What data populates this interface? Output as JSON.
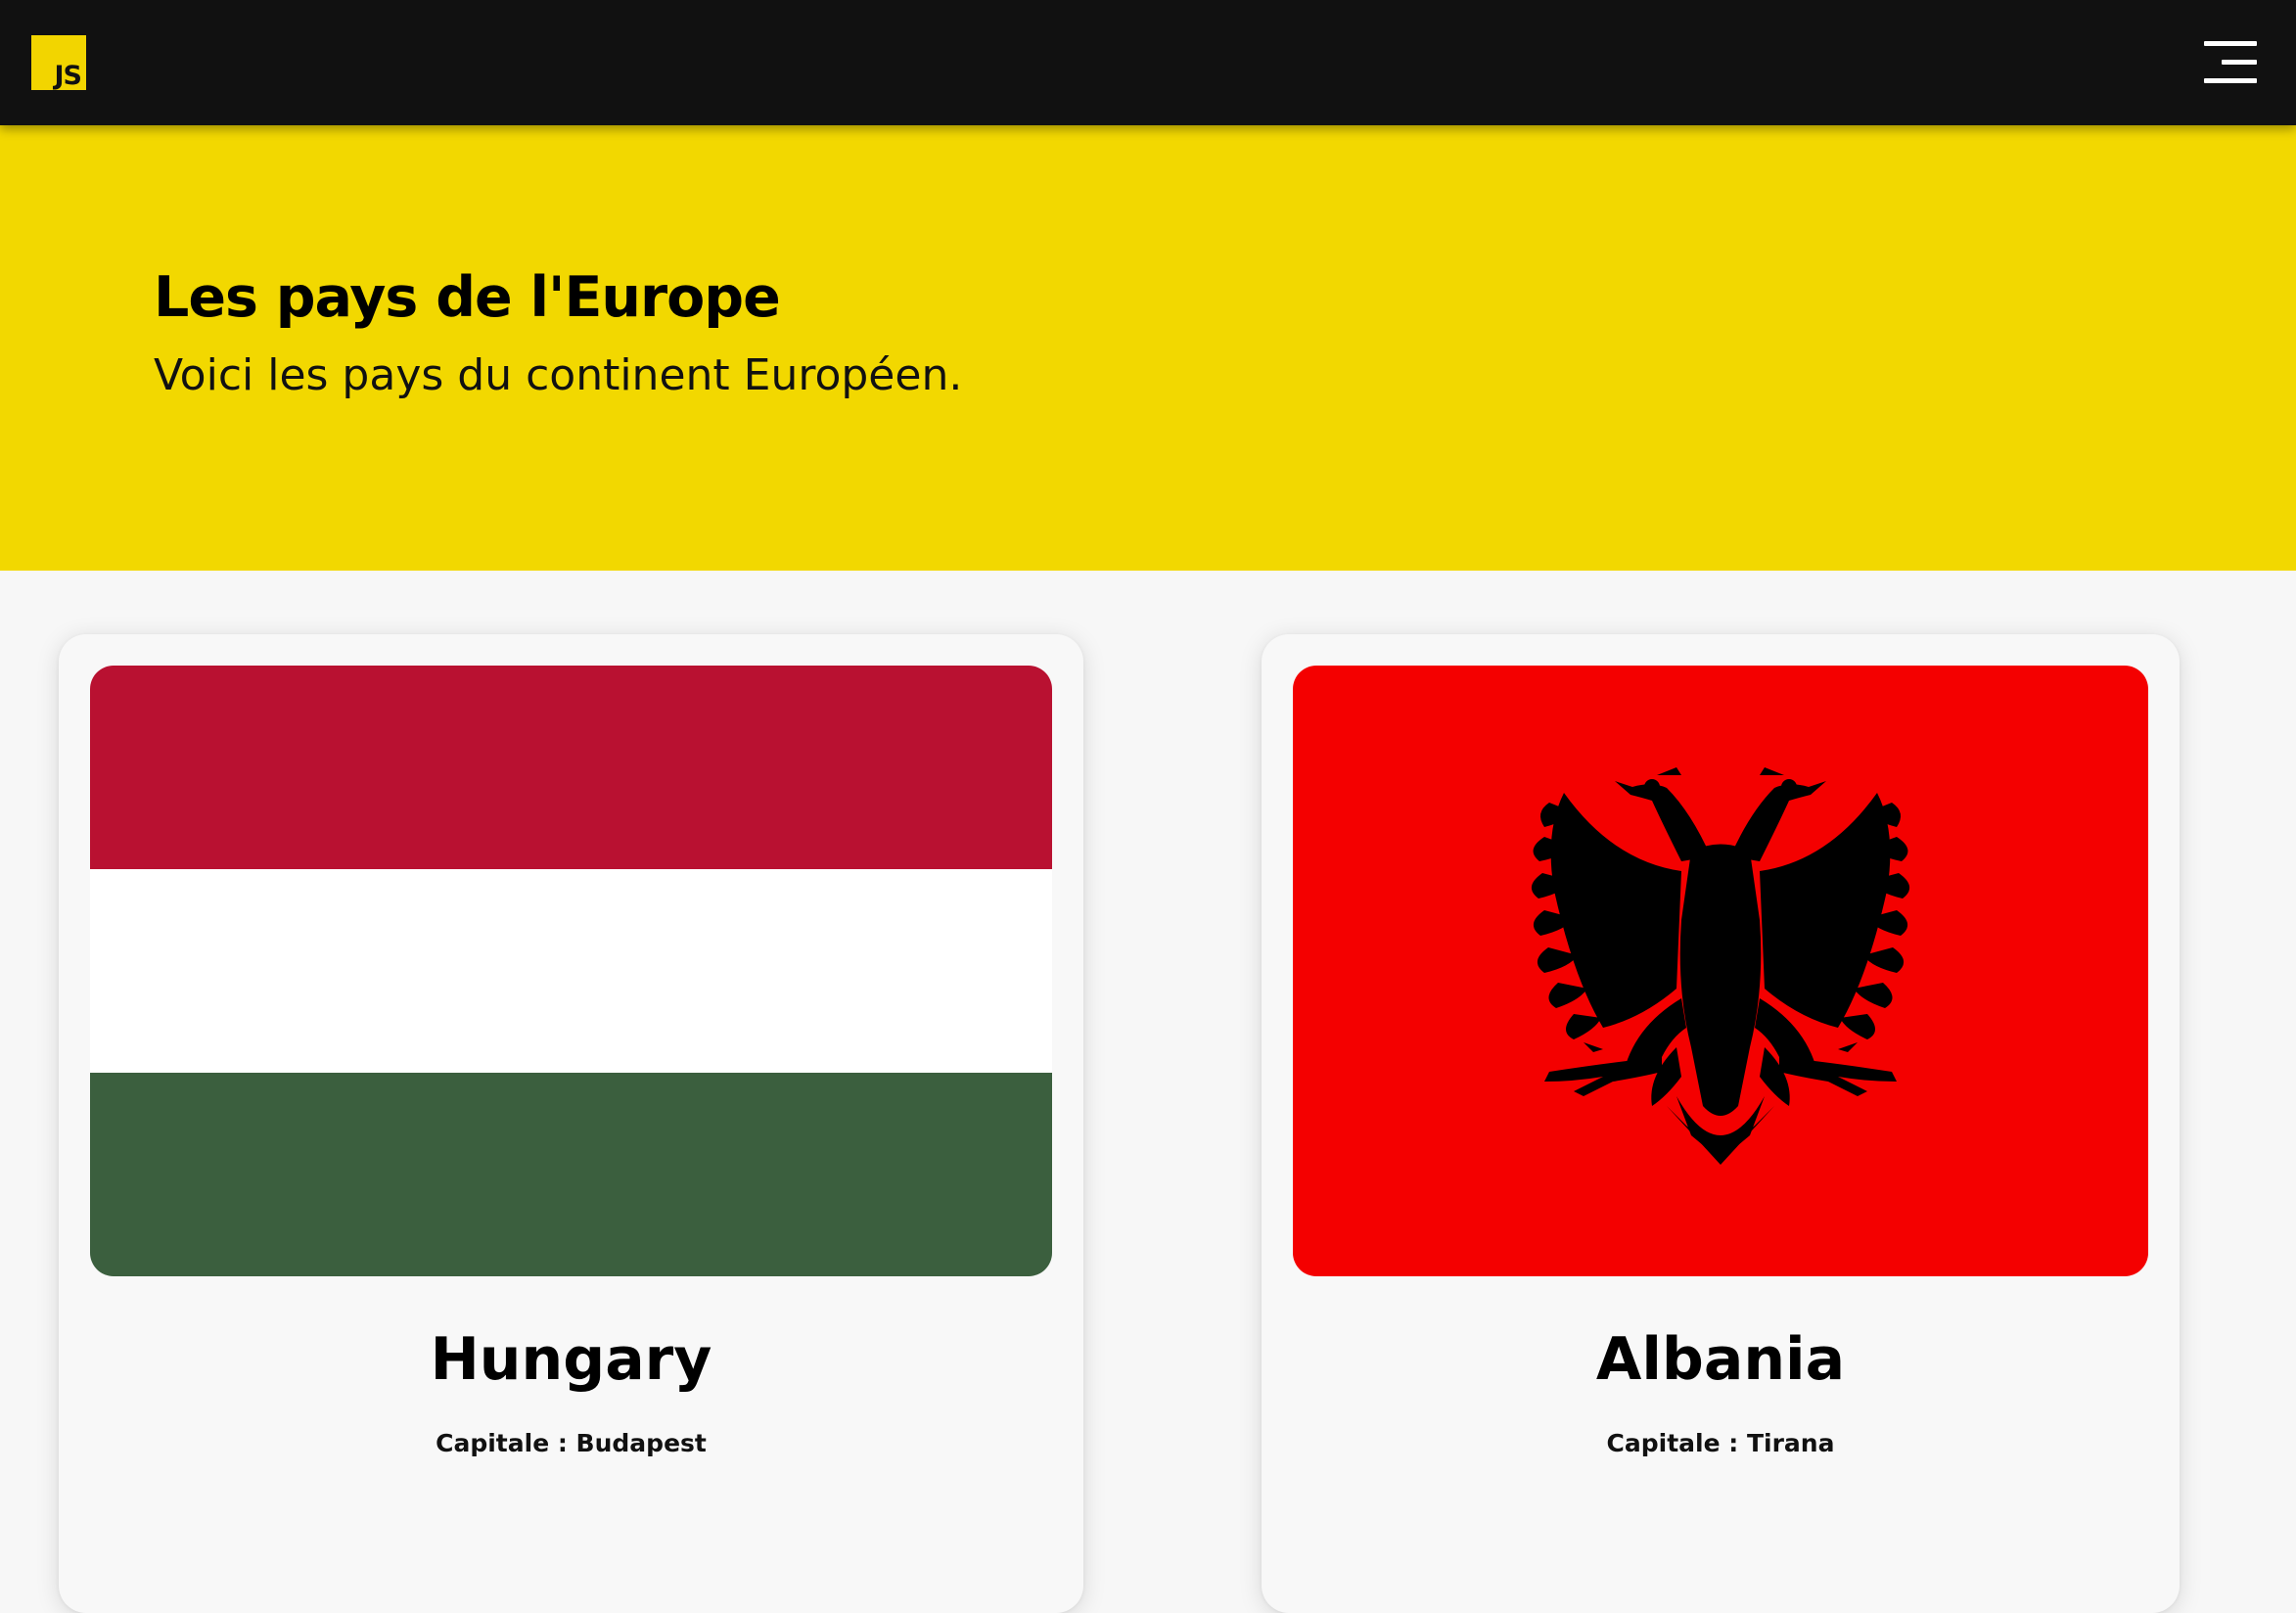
{
  "navbar": {
    "logo_text": "JS",
    "logo_color": "#f2d500",
    "background": "#111111",
    "menu_icon": "hamburger-menu-icon"
  },
  "hero": {
    "title": "Les pays de l'Europe",
    "subtitle": "Voici les pays du continent Européen.",
    "background": "#f2d800"
  },
  "countries": [
    {
      "name": "Hungary",
      "capital_label": "Capitale : Budapest",
      "flag": "hungary-flag",
      "flag_colors": [
        "#b91131",
        "#ffffff",
        "#3b5f3e"
      ]
    },
    {
      "name": "Albania",
      "capital_label": "Capitale : Tirana",
      "flag": "albania-flag",
      "flag_colors": [
        "#f40000",
        "#000000"
      ]
    }
  ]
}
